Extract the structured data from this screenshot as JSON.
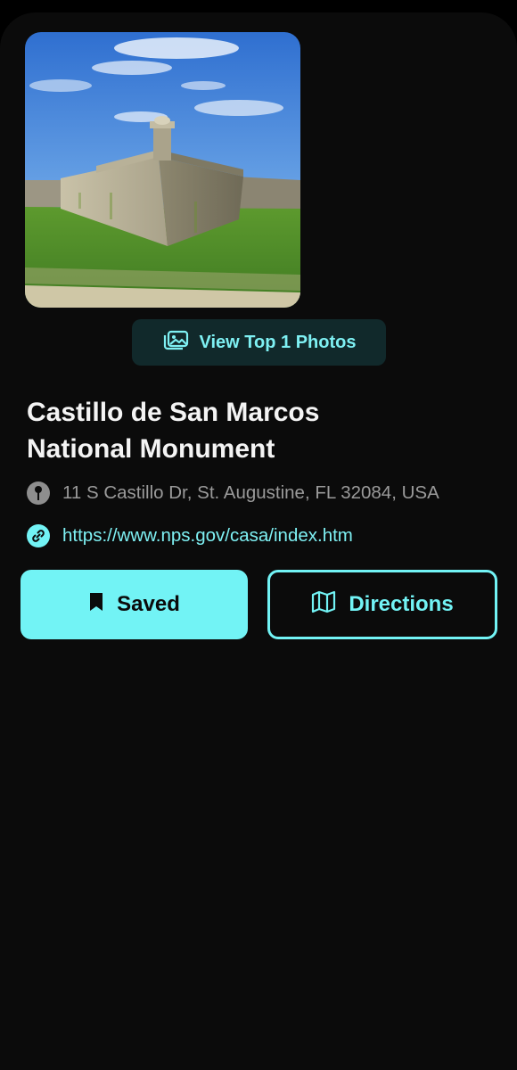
{
  "place": {
    "photo_alt": "Castillo de San Marcos fort photo",
    "photos_button_label": "View Top 1 Photos",
    "title_line1": "Castillo de San Marcos",
    "title_line2": "National Monument",
    "address": "11 S Castillo Dr, St. Augustine, FL 32084, USA",
    "website": "https://www.nps.gov/casa/index.htm"
  },
  "actions": {
    "saved_label": "Saved",
    "directions_label": "Directions"
  },
  "theme": {
    "accent": "#72f3f5",
    "background": "#0b0b0b",
    "title_color": "#f4f4f4",
    "muted_text": "#9a9a9a"
  },
  "icons": {
    "photos": "photos-icon",
    "location": "location-pin-icon",
    "link": "link-icon",
    "saved": "bookmark-icon",
    "directions": "map-icon"
  }
}
